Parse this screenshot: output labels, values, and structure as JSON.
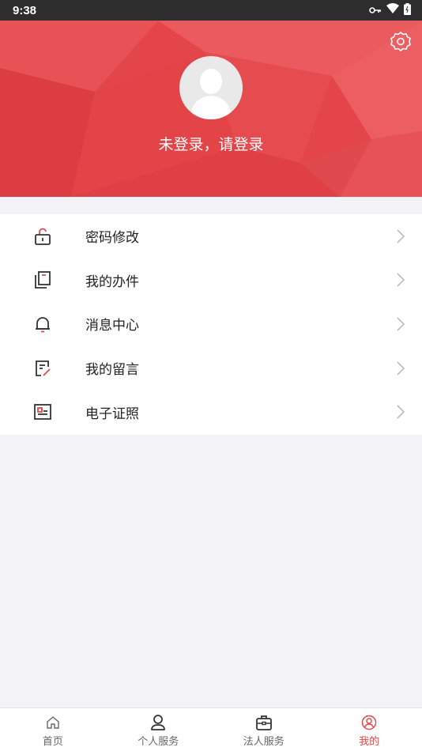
{
  "status_bar": {
    "time": "9:38"
  },
  "header": {
    "login_prompt": "未登录，请登录"
  },
  "menu": {
    "items": [
      {
        "label": "密码修改",
        "icon": "unlock-icon"
      },
      {
        "label": "我的办件",
        "icon": "documents-icon"
      },
      {
        "label": "消息中心",
        "icon": "bell-icon"
      },
      {
        "label": "我的留言",
        "icon": "note-edit-icon"
      },
      {
        "label": "电子证照",
        "icon": "id-card-icon"
      }
    ]
  },
  "bottom_nav": {
    "items": [
      {
        "label": "首页",
        "icon": "home-icon"
      },
      {
        "label": "个人服务",
        "icon": "person-icon"
      },
      {
        "label": "法人服务",
        "icon": "briefcase-icon"
      },
      {
        "label": "我的",
        "icon": "profile-icon",
        "active": true
      }
    ]
  },
  "colors": {
    "accent": "#e5474b",
    "background": "#f3f3f7"
  }
}
